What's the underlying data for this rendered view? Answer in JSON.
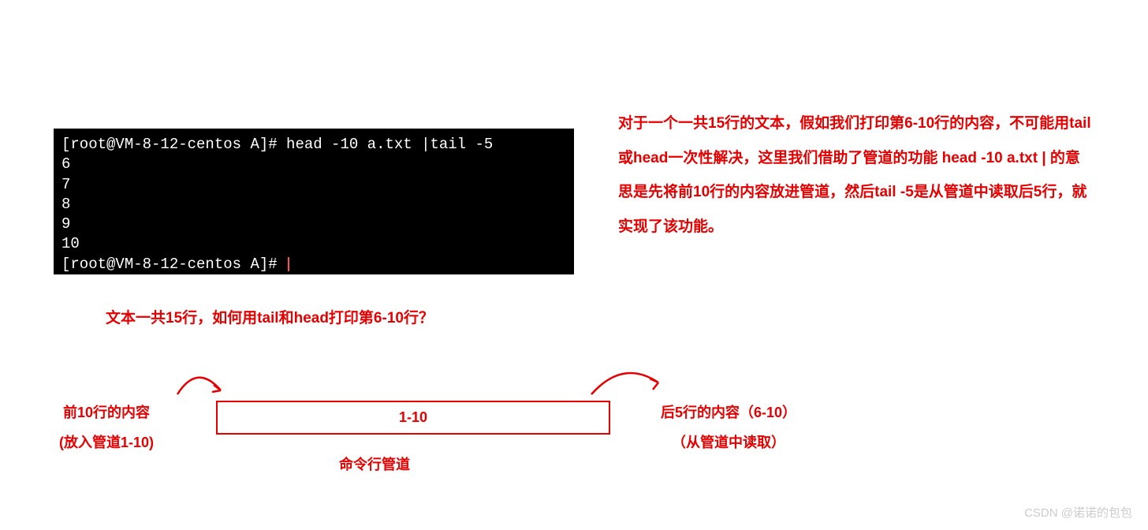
{
  "terminal": {
    "line1_prompt": "[root@VM-8-12-centos A]# ",
    "line1_cmd": "head -10 a.txt |tail -5",
    "output": [
      "6",
      "7",
      "8",
      "9",
      "10"
    ],
    "line2_prompt": "[root@VM-8-12-centos A]# "
  },
  "explanation": {
    "text": "对于一个一共15行的文本，假如我们打印第6-10行的内容，不可能用tail或head一次性解决，这里我们借助了管道的功能 head -10 a.txt | 的意思是先将前10行的内容放进管道，然后tail -5是从管道中读取后5行，就实现了该功能。"
  },
  "question": {
    "text": "文本一共15行，如何用tail和head打印第6-10行？"
  },
  "diagram": {
    "left_line1": "前10行的内容",
    "left_line2": "(放入管道1-10)",
    "pipe_content": "1-10",
    "pipe_label": "命令行管道",
    "right_line1": "后5行的内容（6-10）",
    "right_line2": "（从管道中读取）"
  },
  "watermark": "CSDN @诺诺的包包"
}
